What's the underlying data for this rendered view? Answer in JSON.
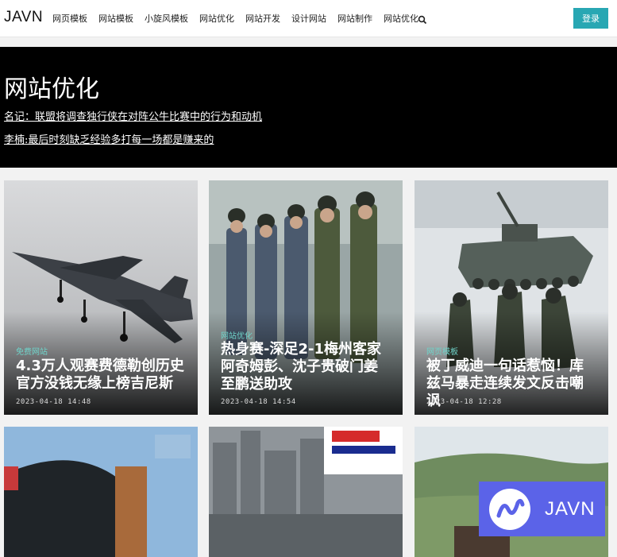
{
  "header": {
    "brand": "JAVN",
    "nav": [
      "网页模板",
      "网站模板",
      "小旋风模板",
      "网站优化",
      "网站开发",
      "设计网站",
      "网站制作",
      "网站优化"
    ],
    "login_label": "登录",
    "search_icon": "search-icon"
  },
  "hero": {
    "title": "网站优化",
    "links": [
      "名记：联盟将调查独行侠在对阵公牛比赛中的行为和动机",
      "李楠:最后时刻缺乏经验多打每一场都是赚来的"
    ]
  },
  "cards": [
    {
      "category": "免费网站",
      "title": "4.3万人观赛费德勒创历史 官方没钱无缘上榜吉尼斯",
      "date": "2023-04-18 14:48"
    },
    {
      "category": "网站优化",
      "title": "热身赛-深足2-1梅州客家阿奇姆彭、沈子贵破门姜至鹏送助攻",
      "date": "2023-04-18 14:54"
    },
    {
      "category": "网页模板",
      "title": "被丁威迪一句话惹恼！库兹马暴走连续发文反击嘲讽",
      "date": "2023-04-18 12:28"
    }
  ],
  "watermark": {
    "text": "JAVN"
  },
  "colors": {
    "accent": "#28a7b3",
    "category": "#6fd3c9",
    "watermark": "#5b63e8"
  }
}
